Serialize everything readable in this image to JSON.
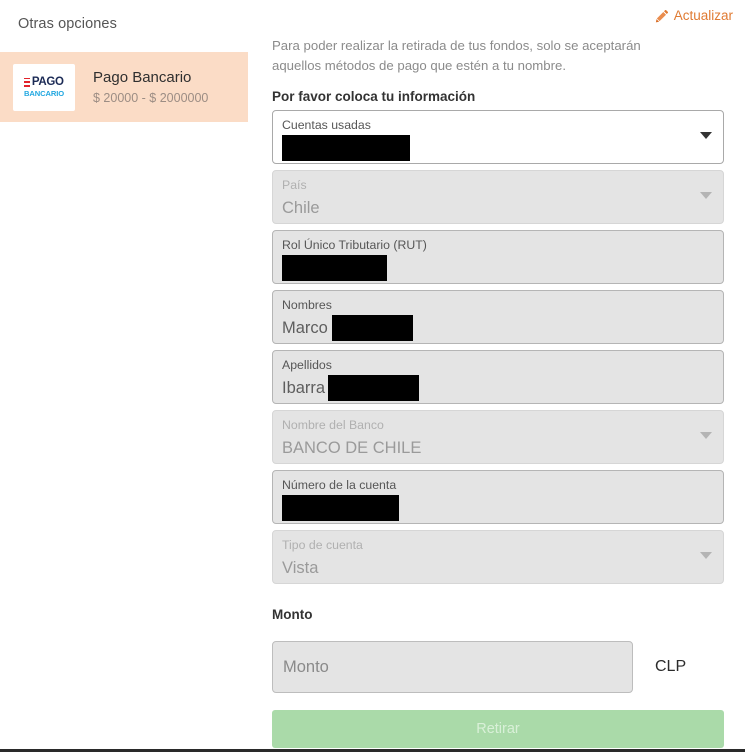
{
  "colors": {
    "accent_orange": "#e07b33",
    "card_peach": "#fbdcc6",
    "button_green": "#aadaa9",
    "field_gray": "#e4e4e4",
    "logo_navy": "#1b2a55",
    "logo_blue": "#21a7e0",
    "logo_red": "#e2232b"
  },
  "left": {
    "heading": "Otras opciones",
    "method": {
      "logo_icon": "pago-bancario-logo",
      "logo_text_primary": "PAGO",
      "logo_text_secondary": "BANCARIO",
      "title": "Pago Bancario",
      "range": "$ 20000 - $ 2000000"
    }
  },
  "right": {
    "update_link": {
      "icon": "pencil-icon",
      "label": "Actualizar"
    },
    "intro_text": "Para poder realizar la retirada de tus fondos, solo se aceptarán aquellos métodos de pago que estén a tu nombre.",
    "section_heading": "Por favor coloca tu información",
    "fields": [
      {
        "name": "cuentas-usadas",
        "label": "Cuentas usadas",
        "value": "",
        "redacted": true,
        "state": "active",
        "control": "select"
      },
      {
        "name": "pais",
        "label": "País",
        "value": "Chile",
        "redacted": false,
        "state": "disabled",
        "control": "select"
      },
      {
        "name": "rut",
        "label": "Rol Único Tributario (RUT)",
        "value": "",
        "redacted": true,
        "state": "filled",
        "control": "text"
      },
      {
        "name": "nombres",
        "label": "Nombres",
        "value": "Marco",
        "redacted": true,
        "state": "filled",
        "control": "text"
      },
      {
        "name": "apellidos",
        "label": "Apellidos",
        "value": "Ibarra",
        "redacted": true,
        "state": "filled",
        "control": "text"
      },
      {
        "name": "nombre-del-banco",
        "label": "Nombre del Banco",
        "value": "BANCO DE CHILE",
        "redacted": false,
        "state": "disabled",
        "control": "select"
      },
      {
        "name": "numero-de-la-cuenta",
        "label": "Número de la cuenta",
        "value": "",
        "redacted": true,
        "state": "filled",
        "control": "text"
      },
      {
        "name": "tipo-de-cuenta",
        "label": "Tipo de cuenta",
        "value": "Vista",
        "redacted": false,
        "state": "disabled",
        "control": "select"
      }
    ],
    "monto": {
      "heading": "Monto",
      "placeholder": "Monto",
      "value": "",
      "currency": "CLP"
    },
    "submit_label": "Retirar"
  }
}
